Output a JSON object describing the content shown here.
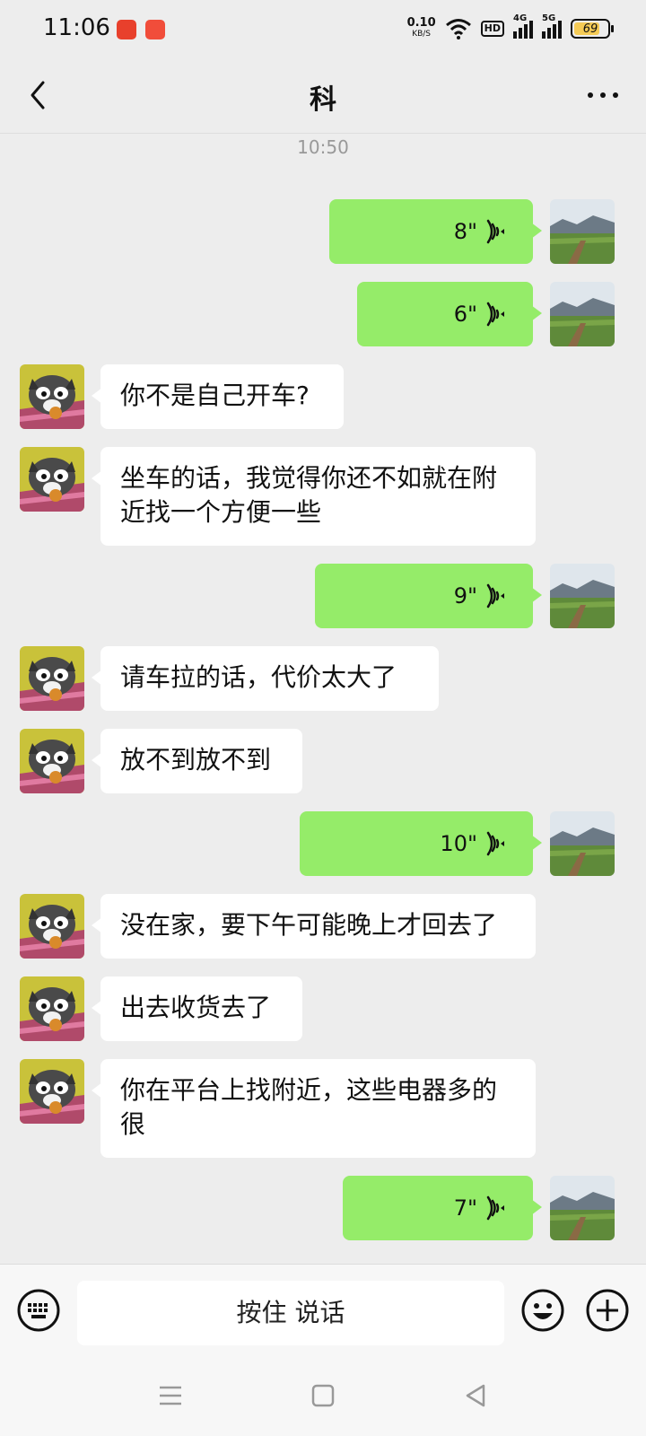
{
  "status": {
    "time": "11:06",
    "net_speed_value": "0.10",
    "net_speed_unit": "KB/S",
    "hd_label": "HD",
    "sig1_label": "4G",
    "sig2_label": "5G",
    "battery": "69",
    "battery_level": 0.69
  },
  "header": {
    "title": "科"
  },
  "timestamp": "10:50",
  "messages": [
    {
      "side": "out",
      "duration": "8\""
    },
    {
      "side": "out",
      "duration": "6\""
    },
    {
      "side": "in",
      "text": "你不是自己开车?"
    },
    {
      "side": "in",
      "text": "坐车的话，我觉得你还不如就在附近找一个方便一些"
    },
    {
      "side": "out",
      "duration": "9\""
    },
    {
      "side": "in",
      "text": "请车拉的话，代价太大了"
    },
    {
      "side": "in",
      "text": "放不到放不到"
    },
    {
      "side": "out",
      "duration": "10\""
    },
    {
      "side": "in",
      "text": "没在家，要下午可能晚上才回去了"
    },
    {
      "side": "in",
      "text": "出去收货去了"
    },
    {
      "side": "in",
      "text": "你在平台上找附近，这些电器多的很"
    },
    {
      "side": "out",
      "duration": "7\""
    }
  ],
  "input": {
    "hold_to_talk": "按住 说话"
  },
  "colors": {
    "outgoing": "#95ec69",
    "incoming": "#ffffff",
    "background": "#ededed"
  }
}
